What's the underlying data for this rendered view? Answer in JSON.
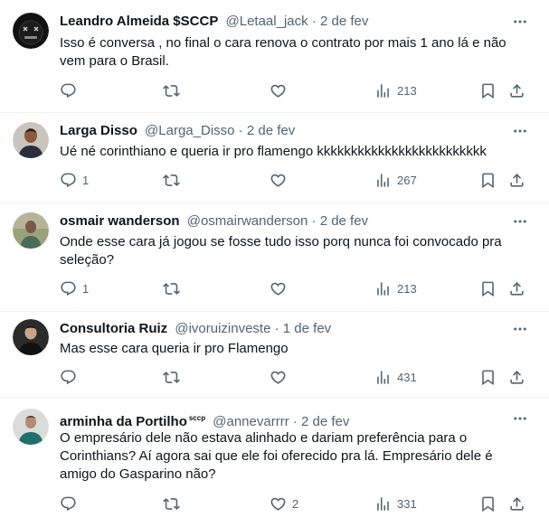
{
  "tweets": [
    {
      "author": "Leandro Almeida $SCCP",
      "handle": "@Letaal_jack",
      "separator": "·",
      "date": "2 de fev",
      "text": "Isso é conversa , no final o cara renova o contrato por mais 1 ano lá e não vem para o Brasil.",
      "replies": "",
      "retweets": "",
      "likes": "",
      "views": "213"
    },
    {
      "author": "Larga Disso",
      "handle": "@Larga_Disso",
      "separator": "·",
      "date": "2 de fev",
      "text": "Ué né corinthiano e queria ir pro flamengo kkkkkkkkkkkkkkkkkkkkkkkkk",
      "replies": "1",
      "retweets": "",
      "likes": "",
      "views": "267"
    },
    {
      "author": "osmair wanderson",
      "handle": "@osmairwanderson",
      "separator": "·",
      "date": "2 de fev",
      "text": "Onde esse cara já jogou se fosse tudo isso porq nunca foi convocado pra seleção?",
      "replies": "1",
      "retweets": "",
      "likes": "",
      "views": "213"
    },
    {
      "author": "Consultoria Ruiz",
      "handle": "@ivoruizinveste",
      "separator": "·",
      "date": "1 de fev",
      "text": "Mas esse cara queria ir pro Flamengo",
      "replies": "",
      "retweets": "",
      "likes": "",
      "views": "431"
    },
    {
      "author": "arminha da Portilho",
      "badge": "sccp",
      "handle": "@annevarrrr",
      "separator": "·",
      "date": "2 de fev",
      "text": "O empresário dele não estava alinhado e dariam preferência para o Corinthians? Aí agora sai que ele foi oferecido pra lá. Empresário dele é amigo do Gasparino não?",
      "replies": "",
      "retweets": "",
      "likes": "2",
      "views": "331"
    }
  ],
  "icons": {
    "reply": "reply-icon",
    "retweet": "retweet-icon",
    "like": "heart-icon",
    "views": "views-icon",
    "bookmark": "bookmark-icon",
    "share": "share-icon",
    "more": "more-icon"
  },
  "colors": {
    "text": "#0f1419",
    "secondary": "#536471",
    "divider": "#eff3f4",
    "background": "#ffffff"
  }
}
